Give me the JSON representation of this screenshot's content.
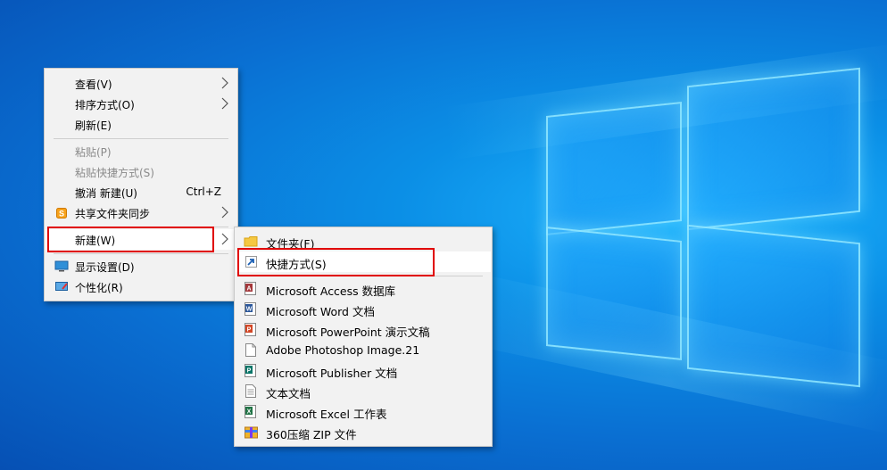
{
  "context_menu": {
    "items": [
      {
        "label": "查看(V)",
        "submenu": true
      },
      {
        "label": "排序方式(O)",
        "submenu": true
      },
      {
        "label": "刷新(E)"
      },
      {
        "label": "粘贴(P)",
        "disabled": true
      },
      {
        "label": "粘贴快捷方式(S)",
        "disabled": true
      },
      {
        "label": "撤消 新建(U)",
        "shortcut": "Ctrl+Z"
      },
      {
        "label": "共享文件夹同步",
        "submenu": true,
        "icon": "shared-folder-sync-icon"
      },
      {
        "label": "新建(W)",
        "submenu": true,
        "highlighted": true
      },
      {
        "label": "显示设置(D)",
        "icon": "display-settings-icon"
      },
      {
        "label": "个性化(R)",
        "icon": "personalize-icon"
      }
    ]
  },
  "new_submenu": {
    "items": [
      {
        "label": "文件夹(F)",
        "icon": "folder-icon"
      },
      {
        "label": "快捷方式(S)",
        "icon": "shortcut-icon",
        "highlighted": true
      },
      {
        "label": "Microsoft Access 数据库",
        "icon": "access-icon"
      },
      {
        "label": "Microsoft Word 文档",
        "icon": "word-icon"
      },
      {
        "label": "Microsoft PowerPoint 演示文稿",
        "icon": "powerpoint-icon"
      },
      {
        "label": "Adobe Photoshop Image.21",
        "icon": "blank-document-icon"
      },
      {
        "label": "Microsoft Publisher 文档",
        "icon": "publisher-icon"
      },
      {
        "label": "文本文档",
        "icon": "text-document-icon"
      },
      {
        "label": "Microsoft Excel 工作表",
        "icon": "excel-icon"
      },
      {
        "label": "360压缩 ZIP 文件",
        "icon": "zip-archive-icon"
      }
    ]
  },
  "colors": {
    "highlight_border": "#e00000",
    "menu_bg": "#f2f2f2",
    "desktop": "#0a78d8"
  }
}
